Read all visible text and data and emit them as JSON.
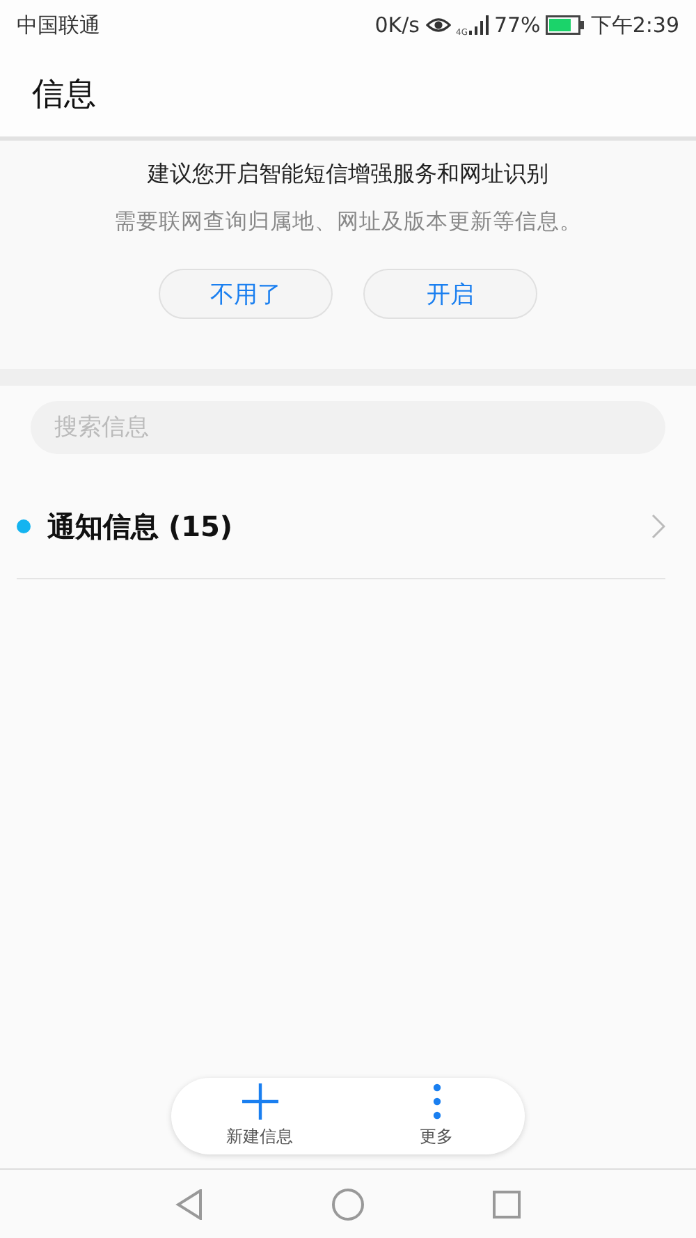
{
  "status_bar": {
    "carrier": "中国联通",
    "speed": "0K/s",
    "network": "4G",
    "battery": "77%",
    "time": "下午2:39"
  },
  "header": {
    "title": "信息"
  },
  "banner": {
    "title": "建议您开启智能短信增强服务和网址识别",
    "subtitle": "需要联网查询归属地、网址及版本更新等信息。",
    "buttons": [
      "不用了",
      "开启"
    ]
  },
  "search": {
    "placeholder": "搜索信息"
  },
  "conversations": [
    {
      "name": "通知信息 (15)",
      "unread": true
    }
  ],
  "bottom_bar": [
    {
      "kind": "add",
      "label": "新建信息"
    },
    {
      "kind": "more",
      "label": "更多"
    }
  ]
}
